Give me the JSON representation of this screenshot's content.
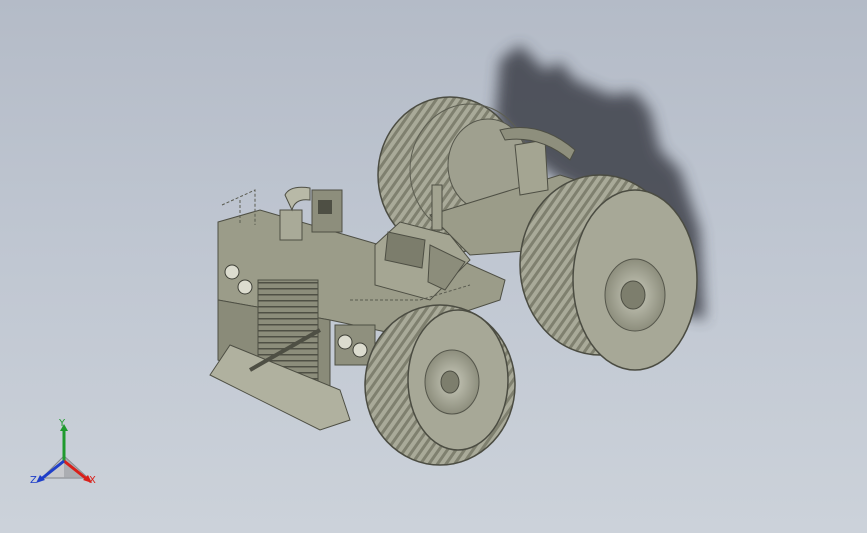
{
  "viewport": {
    "background_top": "#b4bbc7",
    "background_bottom": "#ccd2da"
  },
  "model": {
    "body_color": "#9b9c89",
    "body_dark": "#6f705f",
    "tire_color": "#a7a897",
    "shadow_color": "#3e4148"
  },
  "triad": {
    "x_label": "X",
    "y_label": "Y",
    "z_label": "Z",
    "x_color": "#d9201a",
    "y_color": "#1f9a2e",
    "z_color": "#1f3fc9"
  }
}
